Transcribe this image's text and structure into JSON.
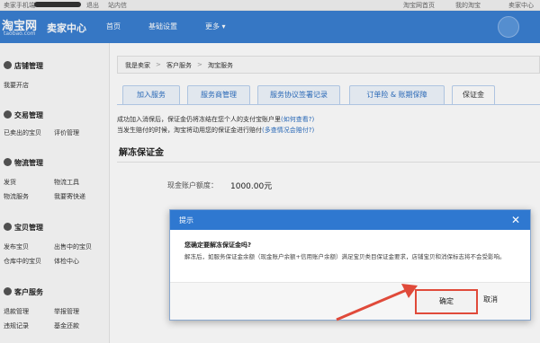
{
  "topbar": {
    "left_items": [
      "卖家手机端",
      "退出",
      "站内信"
    ],
    "right_items": [
      "淘宝网首页",
      "我的淘宝",
      "卖家中心"
    ]
  },
  "nav": {
    "logo_text": "淘宝网",
    "logo_sub": "taobao.com",
    "brand": "卖家中心",
    "items": [
      "首页",
      "基础设置",
      "更多"
    ]
  },
  "sidebar": {
    "sections": [
      {
        "title": "店铺管理",
        "items": [
          "我要开店"
        ]
      },
      {
        "title": "交易管理",
        "items": [
          "已卖出的宝贝",
          "评价管理"
        ]
      },
      {
        "title": "物流管理",
        "items": [
          "发货",
          "物流工具",
          "物流服务",
          "我要寄快递"
        ]
      },
      {
        "title": "宝贝管理",
        "items": [
          "发布宝贝",
          "出售中的宝贝",
          "仓库中的宝贝",
          "体检中心"
        ]
      },
      {
        "title": "客户服务",
        "items": [
          "退款管理",
          "举报管理",
          "违规记录",
          "基金还款"
        ]
      }
    ]
  },
  "breadcrumb": [
    "我是卖家",
    "客户服务",
    "淘宝服务"
  ],
  "tabs": [
    "加入服务",
    "服务商管理",
    "服务协议签署记录",
    "订单险 & 账期保障",
    "保证金"
  ],
  "info": {
    "line1": "成功加入消保后，保证金仍将冻结在您个人的支付宝账户里",
    "line1_link": "(如何查看?)",
    "line2": "当发生赔付的时候，淘宝将动用您的保证金进行赔付",
    "line2_link": "(多查情况会赔付?)"
  },
  "section_title": "解冻保证金",
  "fields": {
    "balance_label": "现金账户额度：",
    "balance_value": "1000.00元"
  },
  "dialog": {
    "title": "提示",
    "close": "✕",
    "question": "您确定要解冻保证金吗?",
    "message": "解冻后，如服务保证金余额（现金账户余额+信用账户余额）满足宝贝类目保证金要求，店铺宝贝和消保标志将不会受影响。",
    "ok_label": "确定",
    "cancel_label": "取消"
  },
  "colors": {
    "nav_blue": "#3a7fd1",
    "dialog_header": "#2f78d0",
    "highlight_red": "#e04a3a",
    "link_blue": "#2c6fc2"
  }
}
